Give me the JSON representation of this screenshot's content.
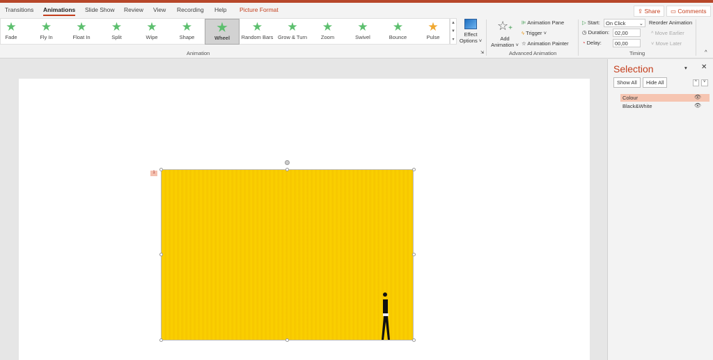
{
  "tabs": [
    "Transitions",
    "Animations",
    "Slide Show",
    "Review",
    "View",
    "Recording",
    "Help",
    "Picture Format"
  ],
  "active_tab": "Animations",
  "header_buttons": {
    "share": "Share",
    "comments": "Comments"
  },
  "gallery": {
    "items": [
      "Fade",
      "Fly In",
      "Float In",
      "Split",
      "Wipe",
      "Shape",
      "Wheel",
      "Random Bars",
      "Grow & Turn",
      "Zoom",
      "Swivel",
      "Bounce",
      "Pulse"
    ],
    "selected": "Wheel",
    "group_label": "Animation"
  },
  "effect_options": {
    "line1": "Effect",
    "line2": "Options ˅"
  },
  "advanced": {
    "add_line1": "Add",
    "add_line2": "Animation ˅",
    "pane": "Animation Pane",
    "trigger": "Trigger ˅",
    "painter": "Animation Painter",
    "group_label": "Advanced Animation"
  },
  "timing": {
    "start_label": "Start:",
    "start_value": "On Click",
    "duration_label": "Duration:",
    "duration_value": "02,00",
    "delay_label": "Delay:",
    "delay_value": "00,00",
    "reorder": "Reorder Animation",
    "earlier": "Move Earlier",
    "later": "Move Later",
    "group_label": "Timing"
  },
  "slide": {
    "animation_tag": "1"
  },
  "selection_pane": {
    "title": "Selection",
    "show_all": "Show All",
    "hide_all": "Hide All",
    "items": [
      {
        "name": "Colour",
        "selected": true
      },
      {
        "name": "Black&White",
        "selected": false
      }
    ]
  },
  "colors": {
    "accent": "#c43e1c",
    "picture": "#f9cb00"
  }
}
